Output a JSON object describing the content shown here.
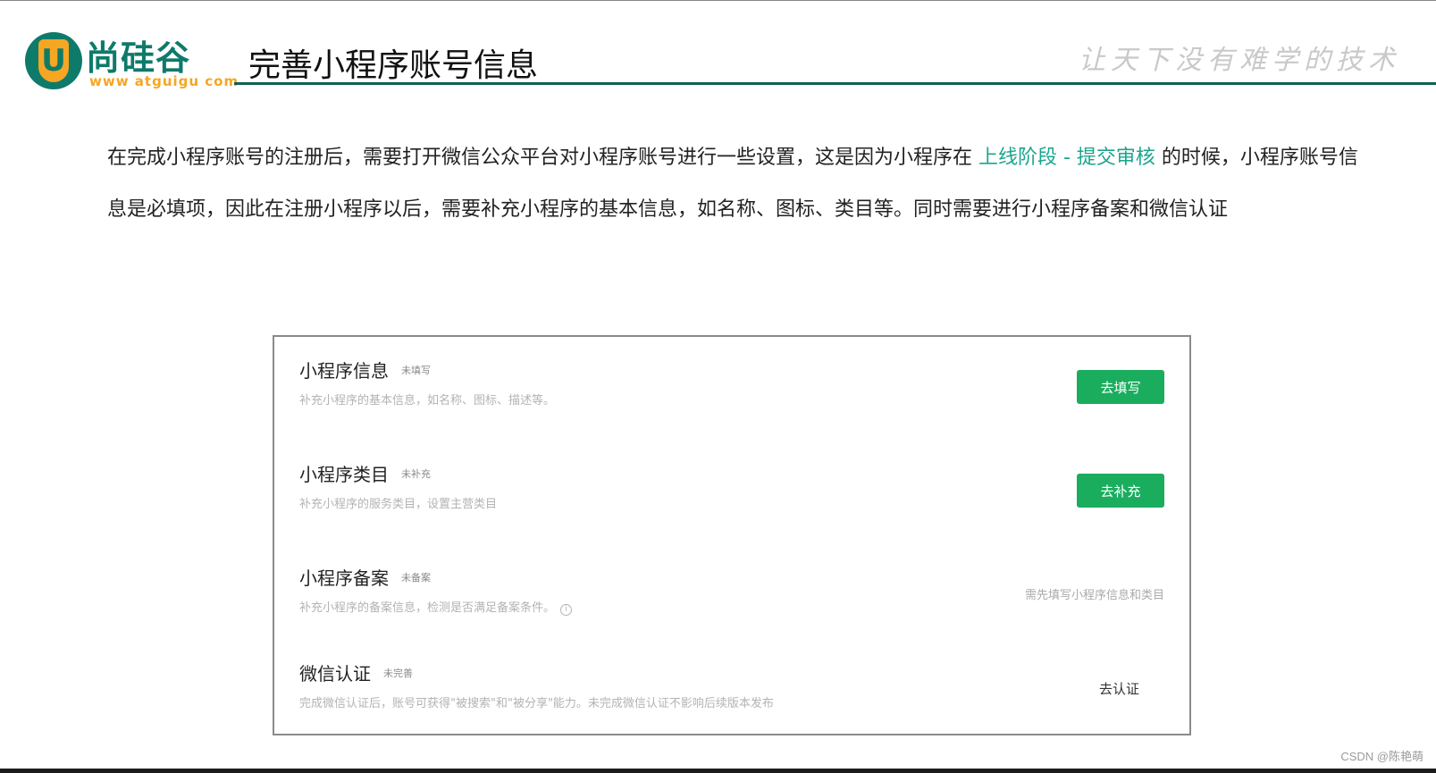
{
  "header": {
    "logo_text": "尚硅谷",
    "logo_url": "www atguigu com",
    "title": "完善小程序账号信息",
    "slogan": "让天下没有难学的技术"
  },
  "intro": {
    "part1": "在完成小程序账号的注册后，需要打开微信公众平台对小程序账号进行一些设置，这是因为小程序在 ",
    "highlight": "上线阶段 - 提交审核",
    "part2": " 的时候，小程序账号信息是必填项，因此在注册小程序以后，需要补充小程序的基本信息，如名称、图标、类目等。同时需要进行小程序备案和微信认证"
  },
  "panel": {
    "items": [
      {
        "title": "小程序信息",
        "badge": "未填写",
        "desc": "补充小程序的基本信息，如名称、图标、描述等。",
        "action": "去填写"
      },
      {
        "title": "小程序类目",
        "badge": "未补充",
        "desc": "补充小程序的服务类目，设置主营类目",
        "action": "去补充"
      },
      {
        "title": "小程序备案",
        "badge": "未备案",
        "desc": "补充小程序的备案信息，检测是否满足备案条件。",
        "hint": "需先填写小程序信息和类目",
        "info_icon": "info-icon"
      },
      {
        "title": "微信认证",
        "badge": "未完善",
        "desc": "完成微信认证后，账号可获得\"被搜索\"和\"被分享\"能力。未完成微信认证不影响后续版本发布",
        "action": "去认证"
      }
    ]
  },
  "credit": "CSDN @陈艳萌",
  "colors": {
    "brand_teal": "#0e7a6a",
    "brand_orange": "#f5a623",
    "highlight": "#1aa58e",
    "button_green": "#1aad5e"
  }
}
